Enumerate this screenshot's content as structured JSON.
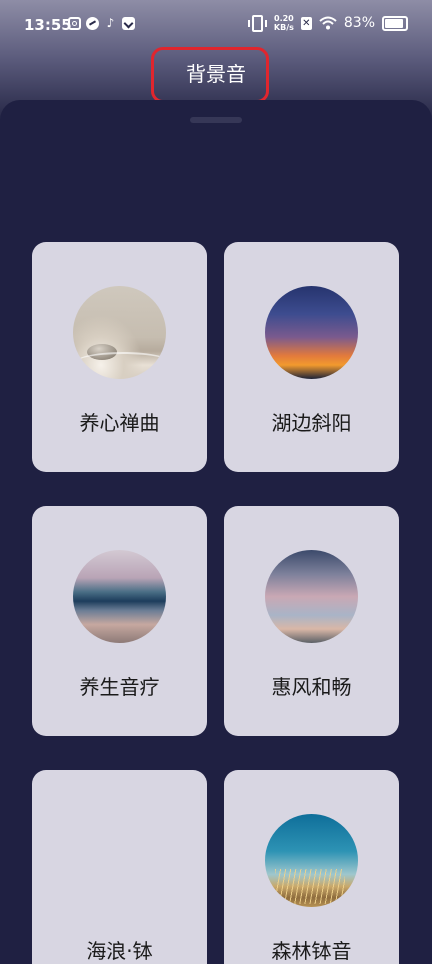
{
  "status_bar": {
    "time": "13:55",
    "net_speed_value": "0.20",
    "net_speed_unit": "KB/s",
    "battery": "83%"
  },
  "page": {
    "title": "背景音"
  },
  "cards": [
    {
      "label": "养心禅曲",
      "thumb": "zen-stones"
    },
    {
      "label": "湖边斜阳",
      "thumb": "lake-sunset"
    },
    {
      "label": "养生音疗",
      "thumb": "sea-horizon"
    },
    {
      "label": "惠风和畅",
      "thumb": "soft-clouds"
    },
    {
      "label": "海浪·钵",
      "thumb": "none"
    },
    {
      "label": "森林钵音",
      "thumb": "golden-grass"
    }
  ],
  "colors": {
    "background": "#1f2042",
    "card": "#d8d6e2",
    "highlight": "#e0262e"
  }
}
